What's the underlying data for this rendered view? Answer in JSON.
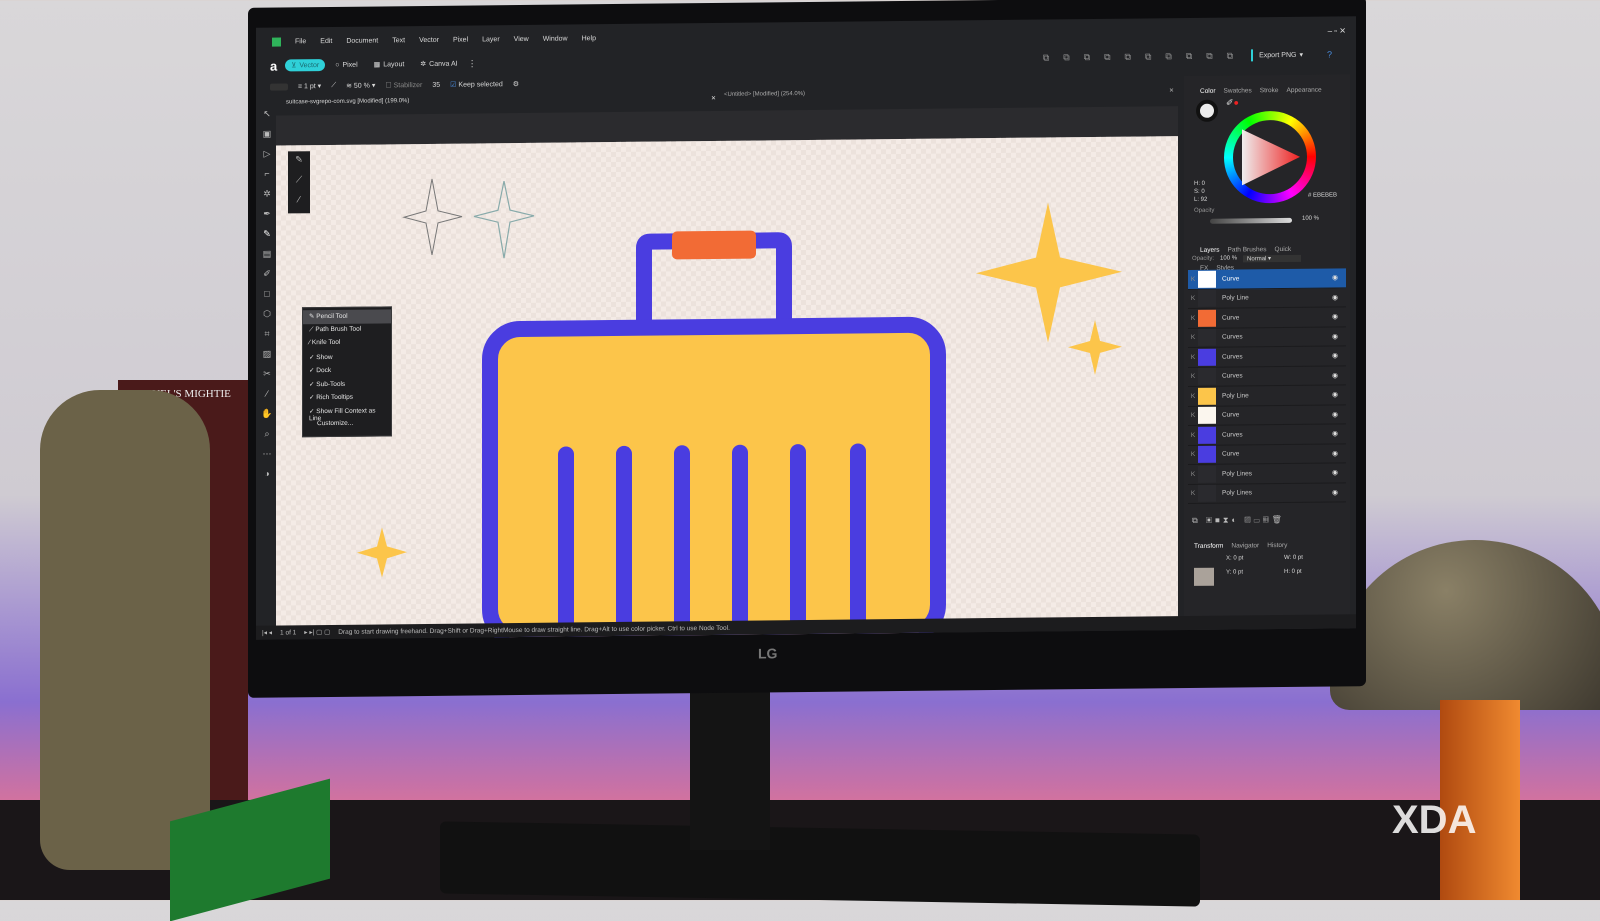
{
  "app": {
    "menu": [
      "File",
      "Edit",
      "Document",
      "Text",
      "Vector",
      "Pixel",
      "Layer",
      "View",
      "Window",
      "Help"
    ],
    "personas": [
      "Vector",
      "Pixel",
      "Layout",
      "Canva AI"
    ],
    "export_label": "Export PNG"
  },
  "context_toolbar": {
    "stroke_width": "1 pt",
    "opacity": "50 %",
    "stabilizer": "Stabilizer",
    "stabilizer_value": "35",
    "keep_selected": "Keep selected"
  },
  "tabs": [
    {
      "title": "suitcase-svgrepo-com.svg [Modified] (199.0%)"
    },
    {
      "title": "<Untitled> [Modified] (254.0%)"
    }
  ],
  "tool_menu": {
    "items": [
      "Pencil Tool",
      "Path Brush Tool",
      "Knife Tool"
    ],
    "checks": [
      "Show",
      "Dock",
      "Sub-Tools",
      "Rich Tooltips",
      "Show Fill Context as Line"
    ],
    "customize": "Customize..."
  },
  "color_panel": {
    "tabs": [
      "Color",
      "Swatches",
      "Stroke",
      "Appearance"
    ],
    "h": "H: 0",
    "s": "S: 0",
    "l": "L: 92",
    "hex": "EBEBEB",
    "opacity_label": "Opacity",
    "opacity": "100 %"
  },
  "layers_panel": {
    "tabs": [
      "Layers",
      "Path Brushes",
      "Quick FX",
      "Styles"
    ],
    "opacity_label": "Opacity:",
    "opacity": "100 %",
    "blend": "Normal",
    "layers": [
      {
        "name": "Curve",
        "thumb": "#ffffff"
      },
      {
        "name": "Poly Line",
        "thumb": ""
      },
      {
        "name": "Curve",
        "thumb": "#f26b35"
      },
      {
        "name": "Curves",
        "thumb": ""
      },
      {
        "name": "Curves",
        "thumb": "#4a3de0"
      },
      {
        "name": "Curves",
        "thumb": ""
      },
      {
        "name": "Poly Line",
        "thumb": "#fcc54a"
      },
      {
        "name": "Curve",
        "thumb": "#fbf6ee"
      },
      {
        "name": "Curves",
        "thumb": "#4a3de0"
      },
      {
        "name": "Curve",
        "thumb": "#4a3de0"
      },
      {
        "name": "Poly Lines",
        "thumb": ""
      },
      {
        "name": "Poly Lines",
        "thumb": ""
      }
    ]
  },
  "transform_panel": {
    "tabs": [
      "Transform",
      "Navigator",
      "History"
    ],
    "x": "X: 0 pt",
    "y": "Y: 0 pt",
    "w": "W: 0 pt",
    "h": "H: 0 pt"
  },
  "status": {
    "page": "1 of 1",
    "hint": "Drag to start drawing freehand. Drag+Shift or Drag+RightMouse to draw straight line. Drag+Alt to use color picker. Ctrl to use Node Tool."
  },
  "monitor_brand": "LG",
  "watermark": "XDA",
  "book_title": "MARVEL'S MIGHTIE",
  "colors": {
    "accent": "#2fd0d8",
    "suitcase_purple": "#4a3de0",
    "suitcase_yellow": "#fcc54a",
    "handle_orange": "#f26b35",
    "layer_selected": "#1e5ba8"
  }
}
